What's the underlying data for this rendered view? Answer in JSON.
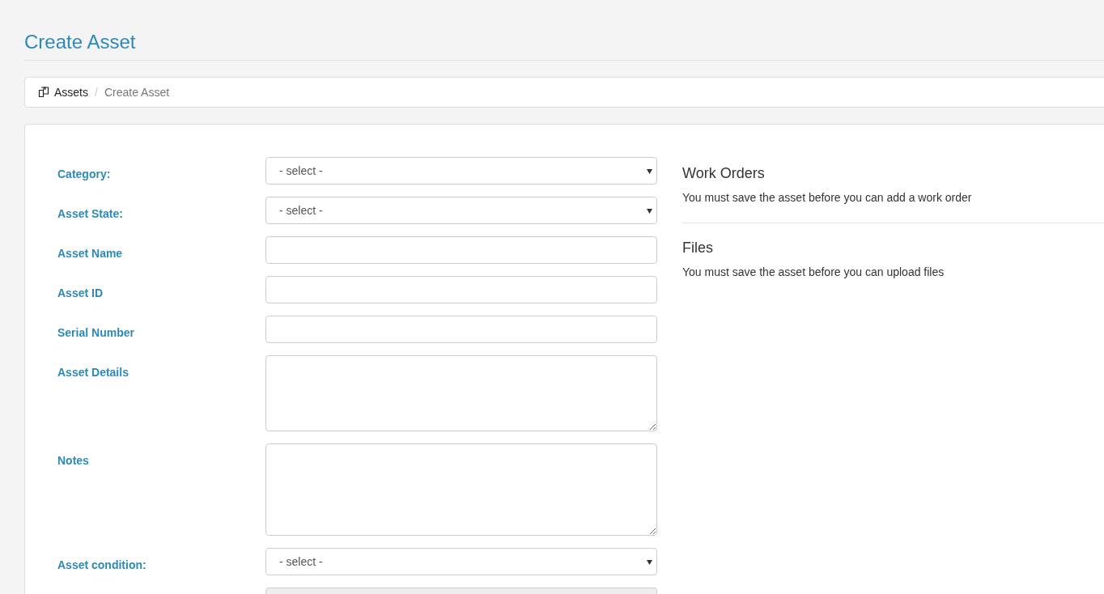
{
  "page": {
    "title": "Create Asset"
  },
  "breadcrumb_separator": "/",
  "breadcrumb": [
    {
      "label": "Assets",
      "current": false
    },
    {
      "label": "Create Asset",
      "current": true
    }
  ],
  "form": {
    "fields": [
      {
        "label": "Category:",
        "kind": "select",
        "value": "- select -"
      },
      {
        "label": "Asset State:",
        "kind": "select",
        "value": "- select -"
      },
      {
        "label": "Asset Name",
        "kind": "text"
      },
      {
        "label": "Asset ID",
        "kind": "text"
      },
      {
        "label": "Serial Number",
        "kind": "text"
      },
      {
        "label": "Asset Details",
        "kind": "textarea"
      },
      {
        "label": "Notes",
        "kind": "tall_textarea"
      },
      {
        "label": "Asset condition:",
        "kind": "select",
        "value": "- select -"
      },
      {
        "kind": "readonly"
      }
    ]
  },
  "sections": [
    {
      "heading": "Work Orders",
      "text": "You must save the asset before you can add a work order"
    },
    {
      "heading": "Files",
      "text": "You must save the asset before you can upload files"
    }
  ]
}
